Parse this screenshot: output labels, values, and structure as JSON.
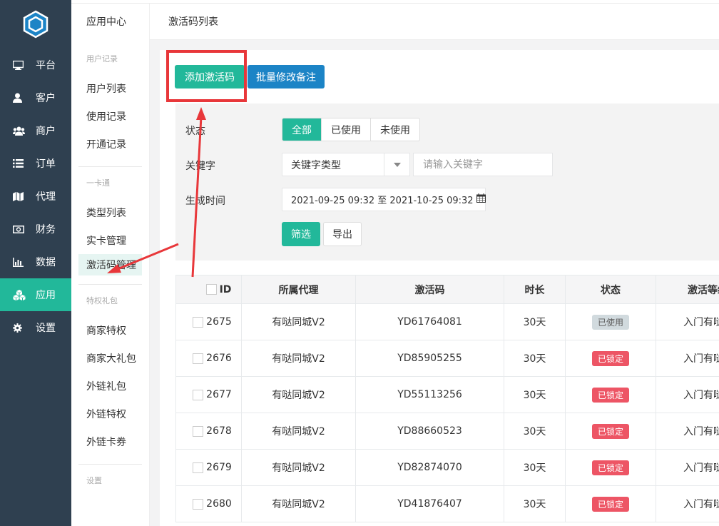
{
  "nav": {
    "items": [
      {
        "label": "平台",
        "icon": "monitor-icon"
      },
      {
        "label": "客户",
        "icon": "user-icon"
      },
      {
        "label": "商户",
        "icon": "users-icon"
      },
      {
        "label": "订单",
        "icon": "list-icon"
      },
      {
        "label": "代理",
        "icon": "map-icon"
      },
      {
        "label": "财务",
        "icon": "money-icon"
      },
      {
        "label": "数据",
        "icon": "bar-chart-icon"
      },
      {
        "label": "应用",
        "icon": "cubes-icon",
        "active": true
      },
      {
        "label": "设置",
        "icon": "gear-icon"
      }
    ]
  },
  "submenu": {
    "title": "应用中心",
    "group1": "用户记录",
    "group1_items": [
      "用户列表",
      "使用记录",
      "开通记录"
    ],
    "group2": "一卡通",
    "group2_items": [
      "类型列表",
      "实卡管理",
      "激活码管理"
    ],
    "group3": "特权礼包",
    "group3_items": [
      "商家特权",
      "商家大礼包",
      "外链礼包",
      "外链特权",
      "外链卡券"
    ],
    "group4": "设置"
  },
  "header": {
    "title": "激活码列表"
  },
  "toolbar": {
    "add_label": "添加激活码",
    "batch_label": "批量修改备注"
  },
  "filter": {
    "status_label": "状态",
    "status_options": [
      "全部",
      "已使用",
      "未使用"
    ],
    "status_selected": "全部",
    "keyword_label": "关键字",
    "keyword_type": "关键字类型",
    "keyword_placeholder": "请输入关键字",
    "time_label": "生成时间",
    "date_range": "2021-09-25 09:32 至 2021-10-25 09:32",
    "filter_label": "筛选",
    "export_label": "导出"
  },
  "table": {
    "headers": [
      "ID",
      "所属代理",
      "激活码",
      "时长",
      "状态",
      "激活等级"
    ],
    "rows": [
      {
        "id": "2675",
        "agent": "有哒同城V2",
        "code": "YD61764081",
        "duration": "30天",
        "status": "已使用",
        "level": "入门有哒卡"
      },
      {
        "id": "2676",
        "agent": "有哒同城V2",
        "code": "YD85905255",
        "duration": "30天",
        "status": "已锁定",
        "level": "入门有哒卡"
      },
      {
        "id": "2677",
        "agent": "有哒同城V2",
        "code": "YD55113256",
        "duration": "30天",
        "status": "已锁定",
        "level": "入门有哒卡"
      },
      {
        "id": "2678",
        "agent": "有哒同城V2",
        "code": "YD88660523",
        "duration": "30天",
        "status": "已锁定",
        "level": "入门有哒卡"
      },
      {
        "id": "2679",
        "agent": "有哒同城V2",
        "code": "YD82874070",
        "duration": "30天",
        "status": "已锁定",
        "level": "入门有哒卡"
      },
      {
        "id": "2680",
        "agent": "有哒同城V2",
        "code": "YD41876407",
        "duration": "30天",
        "status": "已锁定",
        "level": "入门有哒卡"
      }
    ]
  },
  "colors": {
    "accent": "#22b89a",
    "blue": "#1c84c6",
    "sidebar": "#2f4050",
    "annotation": "#e8373a",
    "locked": "#ed5565"
  }
}
